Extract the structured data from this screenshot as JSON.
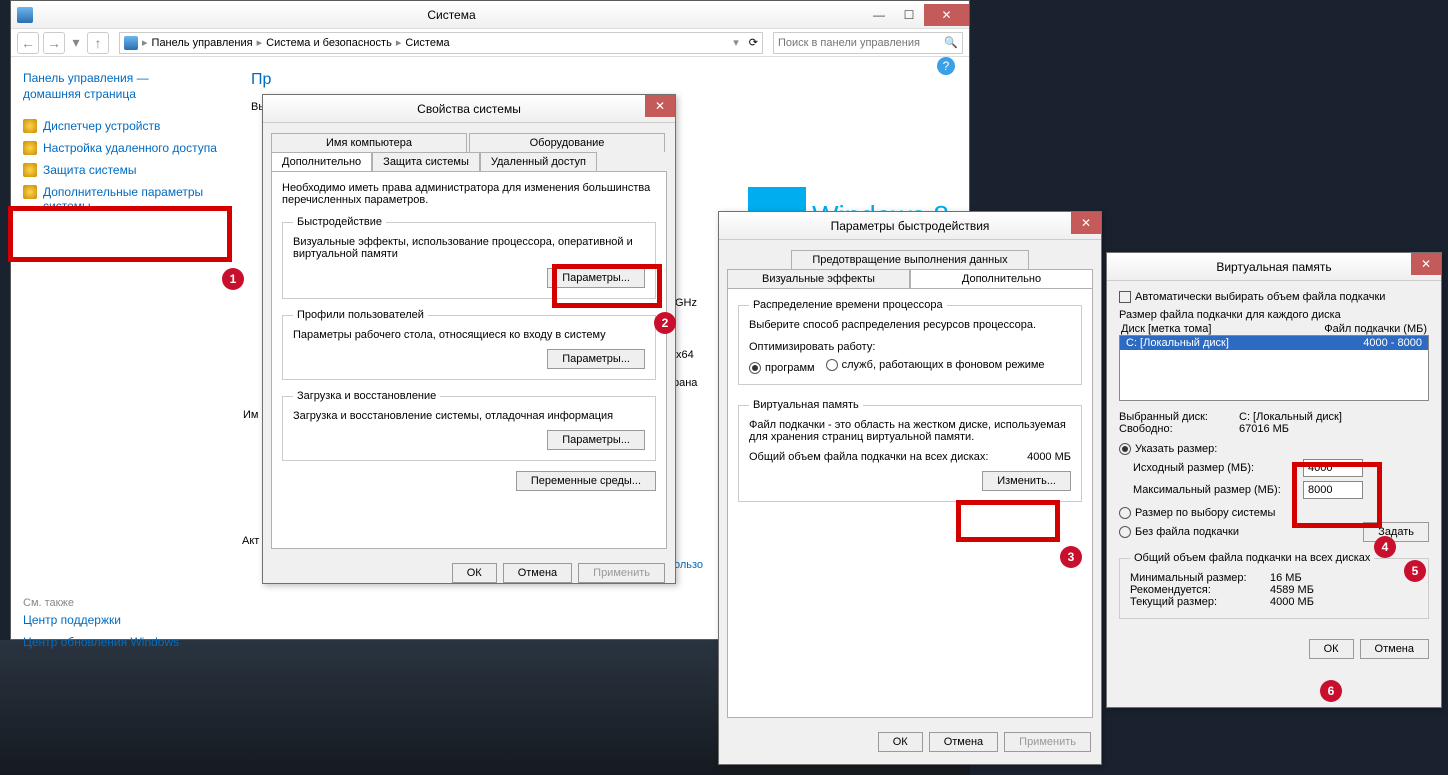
{
  "system_window": {
    "title": "Система",
    "breadcrumb": {
      "root": "Панель управления",
      "mid": "Система и безопасность",
      "leaf": "Система"
    },
    "search_placeholder": "Поиск в панели управления",
    "sidebar": {
      "header1": "Панель управления —",
      "header2": "домашняя страница",
      "links": [
        "Диспетчер устройств",
        "Настройка удаленного доступа",
        "Защита системы",
        "Дополнительные параметры системы"
      ],
      "see_also": "См. также",
      "see_links": [
        "Центр поддержки",
        "Центр обновления Windows"
      ]
    },
    "main": {
      "heading_prefix": "Пр",
      "sub1": "Вы",
      "row_ghz": "GHz",
      "row_arch": "x64",
      "row_country": "рана",
      "row_im": "Им",
      "row_akt": "Акт",
      "link_frag": "пользо",
      "logo_text": "Windows 8"
    }
  },
  "sysprops": {
    "title": "Свойства системы",
    "tabs_top": [
      "Имя компьютера",
      "Оборудование"
    ],
    "tabs_bottom": [
      "Дополнительно",
      "Защита системы",
      "Удаленный доступ"
    ],
    "intro": "Необходимо иметь права администратора для изменения большинства перечисленных параметров.",
    "perf": {
      "legend": "Быстродействие",
      "desc": "Визуальные эффекты, использование процессора, оперативной и виртуальной памяти",
      "btn": "Параметры..."
    },
    "profiles": {
      "legend": "Профили пользователей",
      "desc": "Параметры рабочего стола, относящиеся ко входу в систему",
      "btn": "Параметры..."
    },
    "boot": {
      "legend": "Загрузка и восстановление",
      "desc": "Загрузка и восстановление системы, отладочная информация",
      "btn": "Параметры..."
    },
    "env_btn": "Переменные среды...",
    "ok": "ОК",
    "cancel": "Отмена",
    "apply": "Применить"
  },
  "perfopts": {
    "title": "Параметры быстродействия",
    "tabs_top": [
      "Предотвращение выполнения данных"
    ],
    "tabs_bottom": [
      "Визуальные эффекты",
      "Дополнительно"
    ],
    "sched": {
      "legend": "Распределение времени процессора",
      "desc": "Выберите способ распределения ресурсов процессора.",
      "opt_label": "Оптимизировать работу:",
      "opt_programs": "программ",
      "opt_services": "служб, работающих в фоновом режиме"
    },
    "vm": {
      "legend": "Виртуальная память",
      "desc": "Файл подкачки - это область на жестком диске, используемая для хранения страниц виртуальной памяти.",
      "total_label": "Общий объем файла подкачки на всех дисках:",
      "total_value": "4000 МБ",
      "change": "Изменить..."
    },
    "ok": "ОК",
    "cancel": "Отмена",
    "apply": "Применить"
  },
  "vmem": {
    "title": "Виртуальная память",
    "auto": "Автоматически выбирать объем файла подкачки",
    "perdisk": "Размер файла подкачки для каждого диска",
    "col_disk": "Диск [метка тома]",
    "col_pf": "Файл подкачки (МБ)",
    "row_disk": "C:   [Локальный диск]",
    "row_val": "4000 - 8000",
    "sel_disk_label": "Выбранный диск:",
    "sel_disk_value": "C:  [Локальный диск]",
    "free_label": "Свободно:",
    "free_value": "67016 МБ",
    "opt_custom": "Указать размер:",
    "init_label": "Исходный размер (МБ):",
    "init_value": "4000",
    "max_label": "Максимальный размер (МБ):",
    "max_value": "8000",
    "opt_system": "Размер по выбору системы",
    "opt_none": "Без файла подкачки",
    "set_btn": "Задать",
    "totals_legend": "Общий объем файла подкачки на всех дисках",
    "min_label": "Минимальный размер:",
    "min_value": "16 МБ",
    "rec_label": "Рекомендуется:",
    "rec_value": "4589 МБ",
    "cur_label": "Текущий размер:",
    "cur_value": "4000 МБ",
    "ok": "ОК",
    "cancel": "Отмена"
  },
  "badges": [
    "1",
    "2",
    "3",
    "4",
    "5",
    "6"
  ]
}
